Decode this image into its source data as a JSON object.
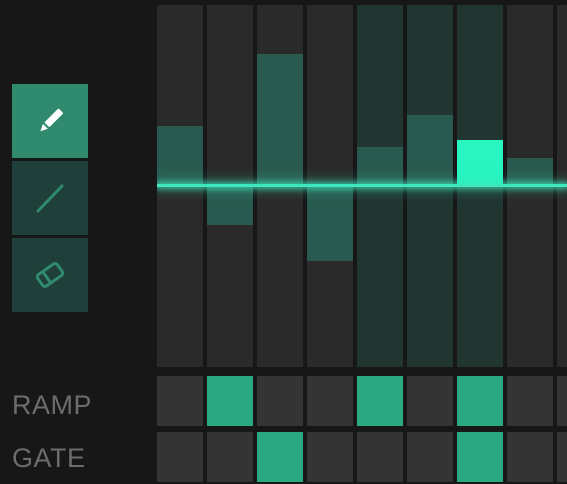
{
  "tools": [
    {
      "name": "pencil",
      "icon": "pencil-icon",
      "active": true
    },
    {
      "name": "line",
      "icon": "line-icon",
      "active": false
    },
    {
      "name": "eraser",
      "icon": "eraser-icon",
      "active": false
    }
  ],
  "steps": [
    {
      "value": 0.33,
      "active": false
    },
    {
      "value": -0.22,
      "active": false
    },
    {
      "value": 0.73,
      "active": false
    },
    {
      "value": -0.42,
      "active": false
    },
    {
      "value": 0.21,
      "active": false
    },
    {
      "value": 0.39,
      "active": false
    },
    {
      "value": 0.25,
      "active": true
    },
    {
      "value": 0.15,
      "active": false
    },
    {
      "value": 0.0,
      "active": false
    }
  ],
  "rows": {
    "ramp": {
      "label": "RAMP",
      "cells": [
        false,
        true,
        false,
        false,
        true,
        false,
        true,
        false,
        false
      ]
    },
    "gate": {
      "label": "GATE",
      "cells": [
        false,
        false,
        true,
        false,
        false,
        false,
        true,
        false,
        false
      ]
    }
  },
  "colors": {
    "accent": "#3fe7bd",
    "bar": "#2a5a4f",
    "bar_active": "#28f5c0",
    "cell_on": "#2aa882",
    "cell_off": "#343434",
    "column": "#2a2a2a",
    "column_highlight": "#213631"
  }
}
